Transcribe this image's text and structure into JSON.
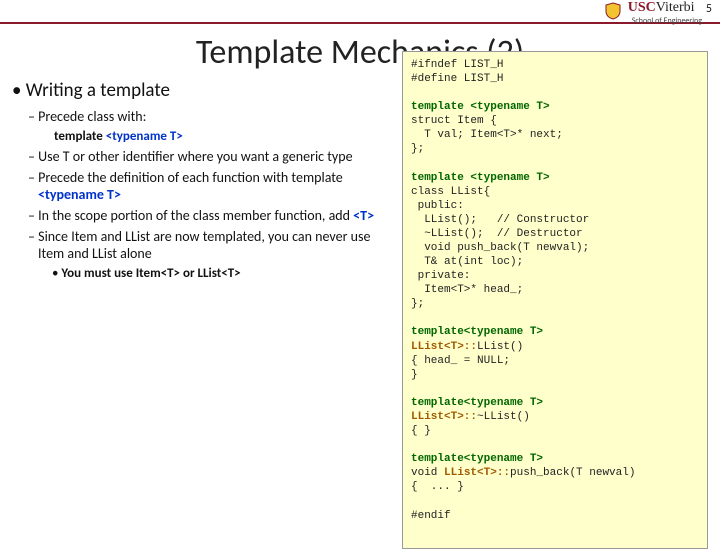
{
  "page": {
    "number": "5"
  },
  "logo": {
    "usc": "USC",
    "viterbi": "Viterbi",
    "sub": "School of Engineering"
  },
  "title": "Template Mechanics (2)",
  "left": {
    "b1": "Writing a template",
    "b2a": "Precede class with:",
    "sub1_pre": "template ",
    "sub1_kw": "<typename T>",
    "b2b": "Use T or other identifier where you want a generic type",
    "b2c_1": "Precede the definition of each function with template ",
    "b2c_2": "<typename T>",
    "b2d_1": "In the scope portion of the class member function, add ",
    "b2d_2": "<T>",
    "b2e": "Since Item and LList are now templated, you can never use Item and LList alone",
    "b3a": "You must use Item<T> or LList<T>"
  },
  "code": {
    "l01": "#ifndef LIST_H",
    "l02": "#define LIST_H",
    "l03": "",
    "tpl": "template <typename T>",
    "l05": "struct Item {",
    "l06": "  T val; Item<T>* next;",
    "l07": "};",
    "l08": "",
    "l10": "class LList{",
    "l11": " public:",
    "l12": "  LList();   // Constructor",
    "l13": "  ~LList();  // Destructor",
    "l14": "  void push_back(T newval);",
    "l15": "  T& at(int loc);",
    "l16": " private:",
    "l17": "  Item<T>* head_;",
    "l18": "};",
    "l19": "",
    "tpl2": "template<typename T>",
    "scope1": "LList<T>::",
    "l21b": "LList()",
    "l22": "{ head_ = NULL;",
    "l23": "}",
    "l24": "",
    "l26b": "~LList()",
    "l27": "{ }",
    "l28": "",
    "l30a": "void ",
    "l30c": "push_back(T newval)",
    "l31": "{  ... }",
    "l32": "",
    "l33": "#endif"
  }
}
